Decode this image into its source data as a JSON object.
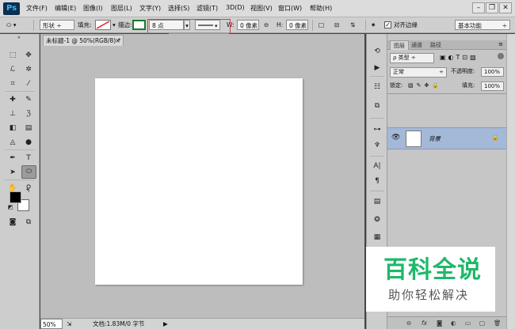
{
  "app": {
    "logo": "Ps"
  },
  "menu": [
    "文件(F)",
    "编辑(E)",
    "图像(I)",
    "图层(L)",
    "文字(Y)",
    "选择(S)",
    "滤镜(T)",
    "3D(D)",
    "视图(V)",
    "窗口(W)",
    "帮助(H)"
  ],
  "window_buttons": {
    "minimize": "–",
    "restore": "❐",
    "close": "✕"
  },
  "options": {
    "shape_mode": "形状",
    "fill_label": "填充:",
    "stroke_label": "描边:",
    "stroke_width": "8 点",
    "w_label": "W:",
    "w_value": "0 像素",
    "h_label": "H:",
    "h_value": "0 像素",
    "align_edges_label": "对齐边缘",
    "workspace": "基本功能",
    "stroke_slider_value_fraction": 0.3
  },
  "document": {
    "tab_title": "未标题-1 @ 50%(RGB/8) *",
    "tab_close": "×",
    "zoom": "50%",
    "status": "文档:1.83M/0 字节"
  },
  "layers": {
    "tabs": [
      "图层",
      "通道",
      "路径"
    ],
    "filter_type": "ρ 类型",
    "blend_mode": "正常",
    "opacity_label": "不透明度:",
    "opacity_value": "100%",
    "lock_label": "锁定:",
    "fill_label": "填充:",
    "fill_value": "100%",
    "layer_name": "背景"
  },
  "watermark": {
    "title": "百科全说",
    "subtitle": "助你轻松解决"
  },
  "colors": {
    "foreground": "#000000",
    "background": "#ffffff",
    "stroke_color": "#1a7a2e",
    "watermark_green": "#1fb86a"
  }
}
